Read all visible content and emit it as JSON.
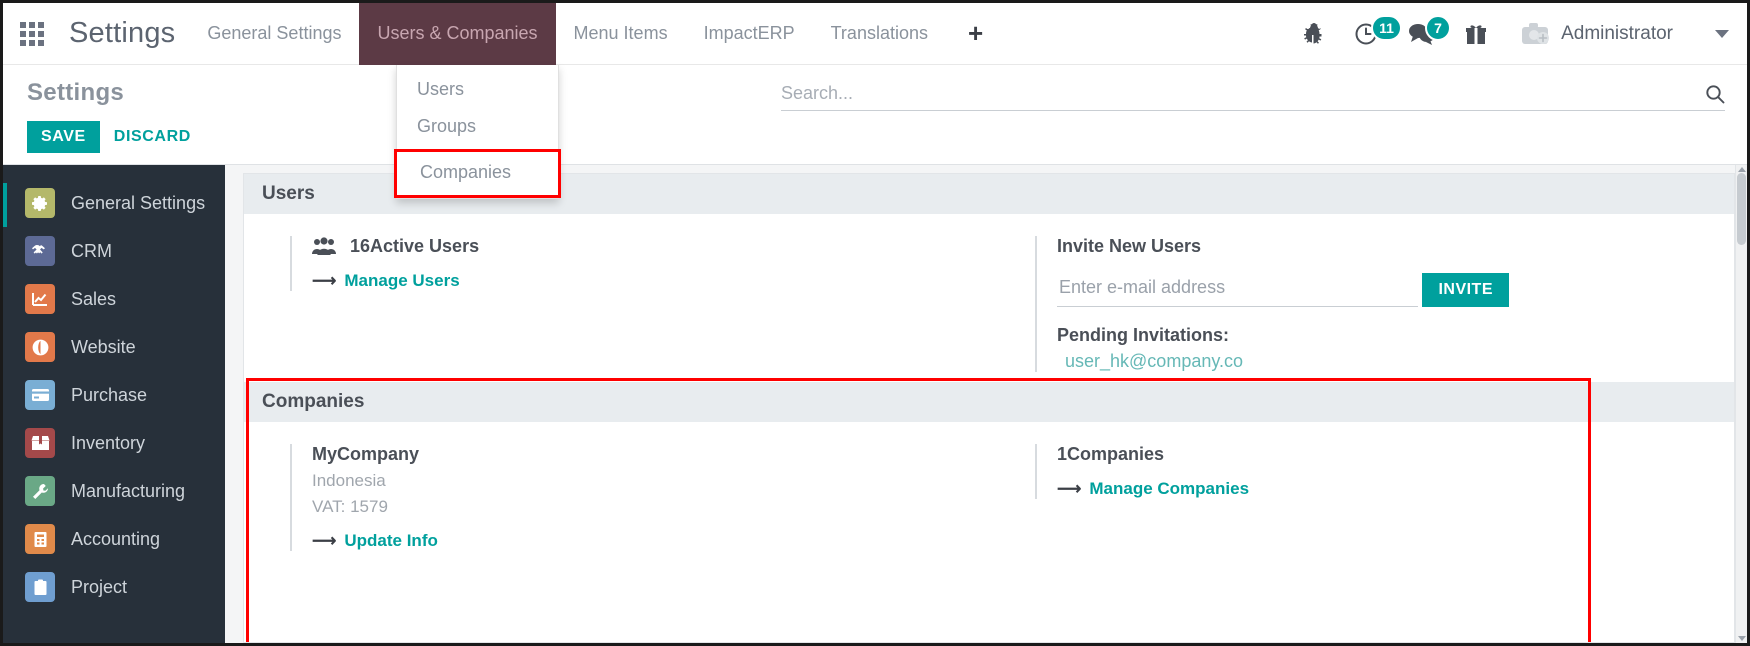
{
  "topbar": {
    "apps_icon": "apps-grid-icon",
    "brand": "Settings",
    "menus": [
      {
        "label": "General Settings",
        "active": false
      },
      {
        "label": "Users & Companies",
        "active": true
      },
      {
        "label": "Menu Items",
        "active": false
      },
      {
        "label": "ImpactERP",
        "active": false
      },
      {
        "label": "Translations",
        "active": false
      }
    ],
    "plus_label": "+",
    "system_icons": [
      {
        "name": "bug-icon",
        "badge": null
      },
      {
        "name": "clock-activity-icon",
        "badge": "11"
      },
      {
        "name": "messages-icon",
        "badge": "7"
      },
      {
        "name": "gift-icon",
        "badge": null
      }
    ],
    "avatar_icon": "camera-avatar-icon",
    "user_name": "Administrator",
    "caret_icon": "chevron-down-icon"
  },
  "dropdown": {
    "items": [
      {
        "label": "Users",
        "highlighted": false
      },
      {
        "label": "Groups",
        "highlighted": false
      },
      {
        "label": "Companies",
        "highlighted": true
      }
    ]
  },
  "control_panel": {
    "title": "Settings",
    "save_label": "SAVE",
    "discard_label": "DISCARD",
    "search_placeholder": "Search...",
    "search_value": "",
    "search_icon": "search-icon"
  },
  "sidebar": {
    "items": [
      {
        "label": "General Settings",
        "icon": "gear-icon",
        "color": "#b4b86a",
        "active": true
      },
      {
        "label": "CRM",
        "icon": "handshake-icon",
        "color": "#5d6a95",
        "active": false
      },
      {
        "label": "Sales",
        "icon": "chart-line-icon",
        "color": "#e2794a",
        "active": false
      },
      {
        "label": "Website",
        "icon": "globe-icon",
        "color": "#e2794a",
        "active": false
      },
      {
        "label": "Purchase",
        "icon": "card-icon",
        "color": "#7aaed4",
        "active": false
      },
      {
        "label": "Inventory",
        "icon": "box-icon",
        "color": "#a4494a",
        "active": false
      },
      {
        "label": "Manufacturing",
        "icon": "wrench-icon",
        "color": "#6aa886",
        "active": false
      },
      {
        "label": "Accounting",
        "icon": "book-icon",
        "color": "#e08a4a",
        "active": false
      },
      {
        "label": "Project",
        "icon": "clipboard-icon",
        "color": "#6f9ed0",
        "active": false
      }
    ]
  },
  "sections": [
    {
      "title": "Users",
      "left": {
        "icon": "users-group-icon",
        "stat": "16Active Users",
        "link": "Manage Users",
        "link_arrow": "arrow-right-icon"
      },
      "right": {
        "heading": "Invite New Users",
        "email_placeholder": "Enter e-mail address",
        "email_value": "",
        "invite_label": "INVITE",
        "pending_title": "Pending Invitations:",
        "pending_emails": [
          "user_hk@company.co"
        ]
      }
    },
    {
      "title": "Companies",
      "highlighted": true,
      "left": {
        "name": "MyCompany",
        "country": "Indonesia",
        "vat": "VAT: 1579",
        "link": "Update Info",
        "link_arrow": "arrow-right-icon"
      },
      "right": {
        "stat": "1Companies",
        "link": "Manage Companies",
        "link_arrow": "arrow-right-icon"
      }
    }
  ],
  "colors": {
    "accent_teal": "#00a09d",
    "active_menu_bg": "#5c3a45",
    "sidebar_bg": "#27303a",
    "highlight_red": "#ff0000"
  }
}
